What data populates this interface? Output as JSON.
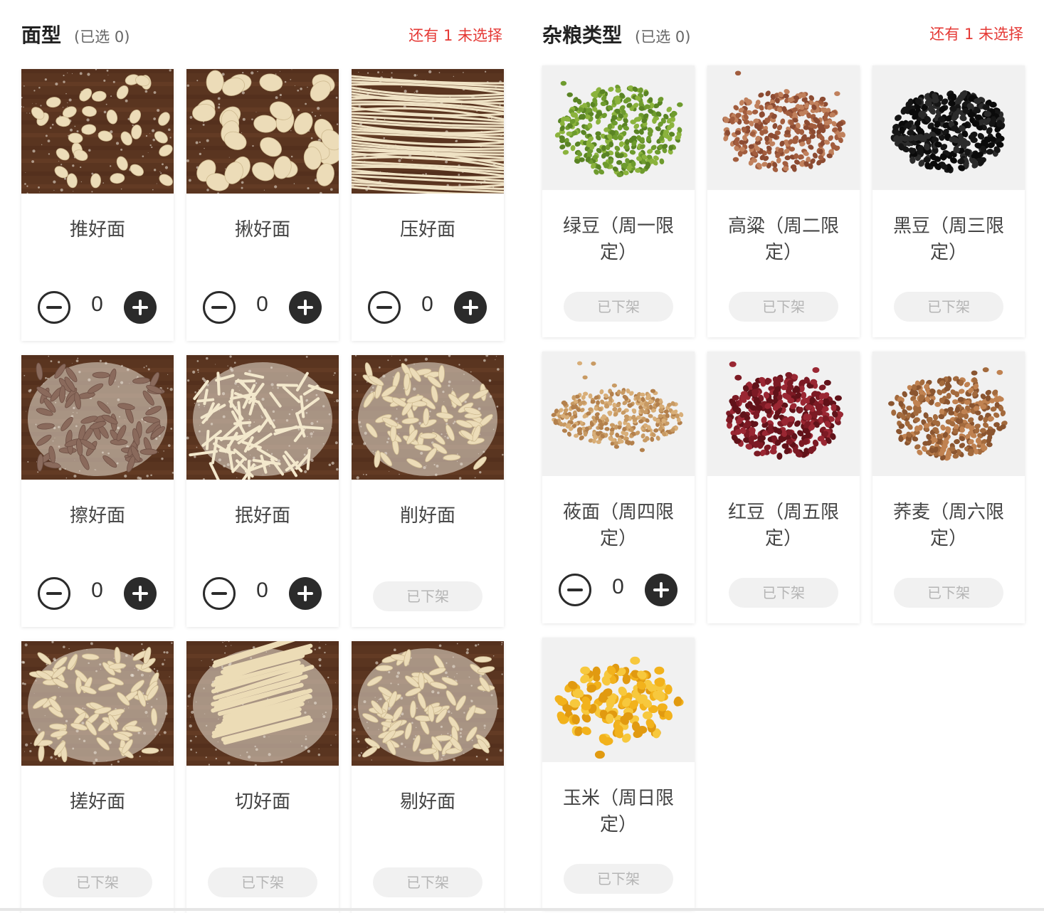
{
  "noodles": {
    "title": "面型",
    "selected": "(已选 0)",
    "remaining": "还有 1 未选择",
    "items": [
      {
        "name": "推好面",
        "qty": "0",
        "available": true,
        "scene": "cavatelli"
      },
      {
        "name": "揪好面",
        "qty": "0",
        "available": true,
        "scene": "flakes"
      },
      {
        "name": "压好面",
        "qty": "0",
        "available": true,
        "scene": "long"
      },
      {
        "name": "擦好面",
        "qty": "0",
        "available": true,
        "scene": "brown"
      },
      {
        "name": "抿好面",
        "qty": "0",
        "available": true,
        "scene": "sticks"
      },
      {
        "name": "削好面",
        "available": false,
        "status": "已下架",
        "scene": "ribbons"
      },
      {
        "name": "搓好面",
        "available": false,
        "status": "已下架",
        "scene": "twists"
      },
      {
        "name": "切好面",
        "available": false,
        "status": "已下架",
        "scene": "strips"
      },
      {
        "name": "剔好面",
        "available": false,
        "status": "已下架",
        "scene": "curls"
      }
    ]
  },
  "grains": {
    "title": "杂粮类型",
    "selected": "(已选 0)",
    "remaining": "还有 1 未选择",
    "items": [
      {
        "name": "绿豆（周一限定）",
        "available": false,
        "status": "已下架",
        "scene": "mungbean"
      },
      {
        "name": "高粱（周二限定）",
        "available": false,
        "status": "已下架",
        "scene": "sorghum"
      },
      {
        "name": "黑豆（周三限定）",
        "available": false,
        "status": "已下架",
        "scene": "blackbean"
      },
      {
        "name": "莜面（周四限定）",
        "qty": "0",
        "available": true,
        "scene": "oat"
      },
      {
        "name": "红豆（周五限定）",
        "available": false,
        "status": "已下架",
        "scene": "redbean"
      },
      {
        "name": "荞麦（周六限定）",
        "available": false,
        "status": "已下架",
        "scene": "buckwheat"
      },
      {
        "name": "玉米（周日限定）",
        "available": false,
        "status": "已下架",
        "scene": "corn"
      }
    ]
  },
  "colors": {
    "accent_red": "#e53935",
    "stepper_dark": "#2b2b2b",
    "offshelf_bg": "#f1f1f1",
    "offshelf_text": "#b5b5b5"
  }
}
